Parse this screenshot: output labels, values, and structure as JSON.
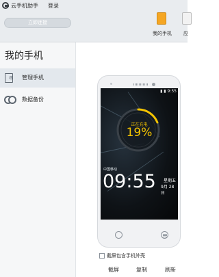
{
  "app": {
    "name": "云手机助手",
    "login_label": "登录",
    "connect_button": "立即连接"
  },
  "tabs": [
    {
      "label": "我的手机",
      "active": true,
      "color": "#f5a623"
    },
    {
      "label": "应",
      "active": false
    }
  ],
  "sidebar": {
    "title": "我的手机",
    "items": [
      {
        "label": "管理手机",
        "icon": "manage-phone-icon",
        "active": true
      },
      {
        "label": "数据备份",
        "icon": "backup-icon",
        "active": false
      }
    ]
  },
  "phone": {
    "status_time": "9:55",
    "charging_label": "正在充电",
    "battery_percent": 19,
    "battery_text": "19%",
    "carrier": "中国移动",
    "clock": "09:55",
    "weekday": "星期五",
    "date": "9月 28 日",
    "accent_color": "#f5c400"
  },
  "screenshot_option": {
    "label": "截屏包含手机外壳",
    "checked": false
  },
  "actions": {
    "screenshot": "截屏",
    "copy": "复制",
    "refresh": "刷新"
  }
}
